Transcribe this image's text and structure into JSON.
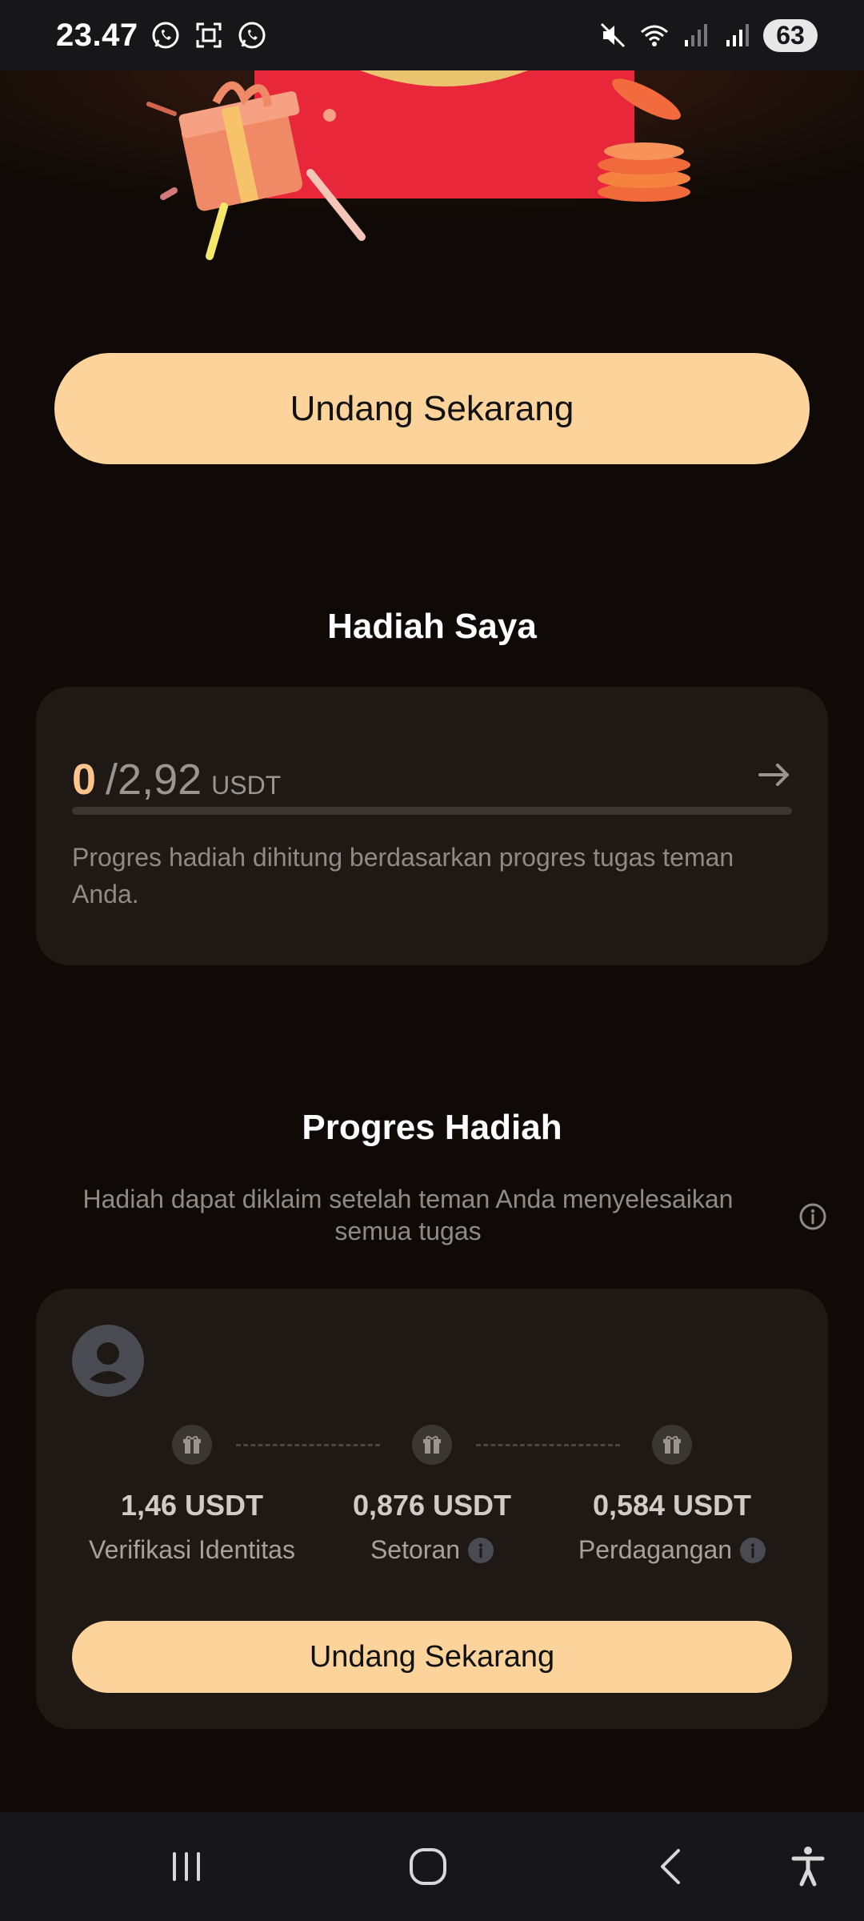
{
  "status_bar": {
    "time": "23.47",
    "battery": "63",
    "icons": [
      "whatsapp-icon",
      "screenshot-icon",
      "whatsapp-icon",
      "mute-icon",
      "wifi-icon",
      "signal-icon",
      "signal-icon"
    ]
  },
  "top_button": {
    "label": "Undang Sekarang"
  },
  "my_rewards": {
    "title": "Hadiah Saya",
    "earned": "0",
    "total": "/2,92",
    "unit": "USDT",
    "progress_fraction": 0,
    "description": "Progres hadiah dihitung berdasarkan progres tugas teman Anda."
  },
  "reward_progress": {
    "title": "Progres Hadiah",
    "subtitle": "Hadiah dapat diklaim setelah teman Anda menyelesaikan semua tugas",
    "steps": [
      {
        "value": "1,46 USDT",
        "label": "Verifikasi Identitas",
        "has_info": false
      },
      {
        "value": "0,876 USDT",
        "label": "Setoran",
        "has_info": true
      },
      {
        "value": "0,584 USDT",
        "label": "Perdagangan",
        "has_info": true
      }
    ],
    "button_label": "Undang Sekarang"
  },
  "colors": {
    "background": "#0f0a07",
    "card": "#1e1915",
    "accent": "#fdd39c",
    "accent_text": "#fdc48c",
    "muted": "#8e8a86"
  },
  "nav_bar": {
    "icons": [
      "recent-apps-icon",
      "home-icon",
      "back-icon",
      "accessibility-icon"
    ]
  }
}
